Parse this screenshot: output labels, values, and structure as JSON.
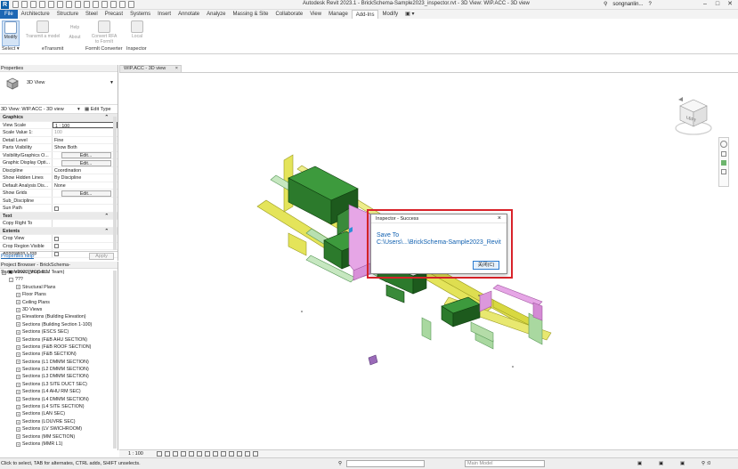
{
  "app": {
    "title": "Autodesk Revit 2023.1 - BrickSchema-Sample2023_inspector.rvt - 3D View: WIP.ACC - 3D view",
    "user": "songnanlin...",
    "logo": "R"
  },
  "ribbon_tabs": [
    {
      "label": "File"
    },
    {
      "label": "Architecture"
    },
    {
      "label": "Structure"
    },
    {
      "label": "Steel"
    },
    {
      "label": "Precast"
    },
    {
      "label": "Systems"
    },
    {
      "label": "Insert"
    },
    {
      "label": "Annotate"
    },
    {
      "label": "Analyze"
    },
    {
      "label": "Massing & Site"
    },
    {
      "label": "Collaborate"
    },
    {
      "label": "View"
    },
    {
      "label": "Manage"
    },
    {
      "label": "Add-Ins"
    },
    {
      "label": "Modify"
    }
  ],
  "ribbon": {
    "modify": "Modify",
    "transmit": "Transmit a model",
    "help": "Help",
    "about": "About",
    "convert_rfa_1": "Convert RFA",
    "convert_rfa_2": "to FormIt",
    "local": "Local",
    "panel_select": "Select ▾",
    "panel_etransmit": "eTransmit",
    "panel_formit": "FormIt Converter",
    "panel_inspector": "Inspector"
  },
  "properties": {
    "title": "Properties",
    "type_name": "3D View",
    "view_selector": "3D View: WIP.ACC - 3D view",
    "edit_type": "Edit Type",
    "rows": [
      {
        "k": "Graphics",
        "group": true
      },
      {
        "k": "View Scale",
        "v": "1 : 100"
      },
      {
        "k": "Scale Value    1:",
        "v": "100",
        "gray": true
      },
      {
        "k": "Detail Level",
        "v": "Fine"
      },
      {
        "k": "Parts Visibility",
        "v": "Show Both"
      },
      {
        "k": "Visibility/Graphics O...",
        "v": "Edit...",
        "btn": true
      },
      {
        "k": "Graphic Display Opti...",
        "v": "Edit...",
        "btn": true
      },
      {
        "k": "Discipline",
        "v": "Coordination"
      },
      {
        "k": "Show Hidden Lines",
        "v": "By Discipline"
      },
      {
        "k": "Default Analysis Dis...",
        "v": "None"
      },
      {
        "k": "Show Grids",
        "v": "Edit...",
        "btn": true
      },
      {
        "k": "Sub_Discipline",
        "v": ""
      },
      {
        "k": "Sun Path",
        "check": true
      },
      {
        "k": "Text",
        "group": true
      },
      {
        "k": "Copy Right To",
        "v": ""
      },
      {
        "k": "Extents",
        "group": true
      },
      {
        "k": "Crop View",
        "check": true
      },
      {
        "k": "Crop Region Visible",
        "check": true
      },
      {
        "k": "Annotation Crop",
        "check": true
      }
    ],
    "help_link": "Properties help",
    "apply": "Apply"
  },
  "browser": {
    "title": "Project Browser - BrickSchema-Sample2023_inspec...",
    "items": [
      {
        "label": "Views (MCC BIM Team)",
        "level": 0,
        "exp": "-"
      },
      {
        "label": "???",
        "level": 1,
        "exp": "-"
      },
      {
        "label": "Structural Plans",
        "level": 2,
        "exp": "+"
      },
      {
        "label": "Floor Plans",
        "level": 2,
        "exp": "+"
      },
      {
        "label": "Ceiling Plans",
        "level": 2,
        "exp": "+"
      },
      {
        "label": "3D Views",
        "level": 2,
        "exp": "+"
      },
      {
        "label": "Elevations (Building Elevation)",
        "level": 2,
        "exp": "+"
      },
      {
        "label": "Sections (Building Section 1-100)",
        "level": 2,
        "exp": "+"
      },
      {
        "label": "Sections (ESCS SEC)",
        "level": 2,
        "exp": "+"
      },
      {
        "label": "Sections (F&B AHU SECTION)",
        "level": 2,
        "exp": "+"
      },
      {
        "label": "Sections (F&B ROOF SECTION)",
        "level": 2,
        "exp": "+"
      },
      {
        "label": "Sections (F&B SECTION)",
        "level": 2,
        "exp": "+"
      },
      {
        "label": "Sections (L1 DMMM SECTION)",
        "level": 2,
        "exp": "+"
      },
      {
        "label": "Sections (L2 DMMM SECTION)",
        "level": 2,
        "exp": "+"
      },
      {
        "label": "Sections (L3 DMMM SECTION)",
        "level": 2,
        "exp": "+"
      },
      {
        "label": "Sections (L3 SITE DUCT SEC)",
        "level": 2,
        "exp": "+"
      },
      {
        "label": "Sections (L4 AHU RM SEC)",
        "level": 2,
        "exp": "+"
      },
      {
        "label": "Sections (L4 DMMM SECTION)",
        "level": 2,
        "exp": "+"
      },
      {
        "label": "Sections (L4 SITE SECTION)",
        "level": 2,
        "exp": "+"
      },
      {
        "label": "Sections (LAN SEC)",
        "level": 2,
        "exp": "+"
      },
      {
        "label": "Sections (LOUVRE SEC)",
        "level": 2,
        "exp": "+"
      },
      {
        "label": "Sections (LV SWICHROOM)",
        "level": 2,
        "exp": "+"
      },
      {
        "label": "Sections (MM SECTION)",
        "level": 2,
        "exp": "+"
      },
      {
        "label": "Sections (MMR L1)",
        "level": 2,
        "exp": "+"
      }
    ]
  },
  "view_tab": {
    "label": "WIP.ACC - 3D view"
  },
  "viewcube": {
    "label": "LEFT"
  },
  "view_control": {
    "scale": "1 : 100"
  },
  "dialog": {
    "title": "Inspector - Success",
    "line1": "Save To",
    "line2": "C:\\Users\\...\\BrickSchema-Sample2023_Revit",
    "ok": "关闭(C)"
  },
  "status": {
    "message": "Click to select, TAB for alternates, CTRL adds, SHIFT unselects.",
    "model": "Main Model"
  },
  "colors": {
    "accent": "#1d67b4",
    "highlight": "#d9232a"
  }
}
